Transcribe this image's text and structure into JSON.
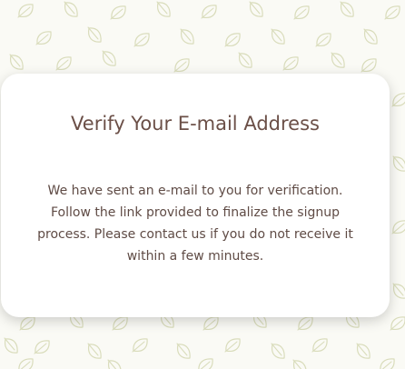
{
  "page": {
    "background_color": "#fafaf5",
    "leaf_pattern_color": "#d9dcbb",
    "leaf_pattern_icon": "leaf-icon"
  },
  "card": {
    "title": "Verify Your E-mail Address",
    "message": "We have sent an e-mail to you for verification. Follow the link provided to finalize the signup process. Please contact us if you do not receive it within a few minutes.",
    "title_color": "#6b4f47",
    "text_color": "#5f4b45",
    "background_color": "#ffffff"
  }
}
